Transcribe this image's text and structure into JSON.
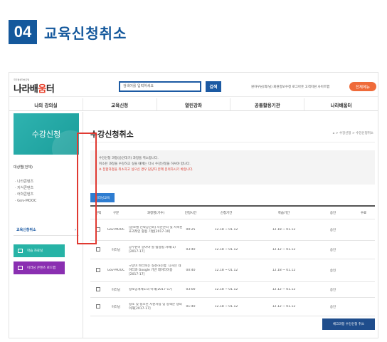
{
  "heading": {
    "number": "04",
    "title": "교육신청취소"
  },
  "site": {
    "logo_sub": "국가평생학습포털",
    "logo_part1": "나라배",
    "logo_part2": "움",
    "logo_part3": "터",
    "search_placeholder": "검색어를 입력하세요",
    "search_button": "검색",
    "util_links": "원하우님(외/님) 회원정보수정 로그아웃 고객지원 사이트맵",
    "sitemap_button": "전체메뉴"
  },
  "gnb": [
    "나의 강의실",
    "교육신청",
    "열린강좌",
    "공통활용기관",
    "나라배움터"
  ],
  "sidebar": {
    "hero": "수강신청",
    "section1": "대상별(전체)",
    "sub_items": [
      "· 나라콘텐츠",
      "· 지식콘텐츠",
      "· 어학콘텐츠",
      "· Gov-MOOC"
    ],
    "active": "교육신청취소",
    "active_arrow": "›",
    "buttons": [
      {
        "label": "학습 자료실",
        "color": "#27b3a6"
      },
      {
        "label": "이러닝 콘텐츠 로드맵",
        "color": "#8a2fb1"
      }
    ]
  },
  "main": {
    "title": "수강신청취소",
    "location": "⌂ > 수강신청 > 수강신청취소",
    "notice": [
      "수강신청 과정(승인대기) 과정을 취소합니다.",
      "취소된 과정을 수강하고 싶을 때에는 다시 수강신청을 하셔야 합니다.",
      "※ 집합과정을 취소하고 싶으신 경우 담당자 분께 문의하시기 바랍니다."
    ],
    "tab": "이러닝교육",
    "columns": [
      "선택",
      "구분",
      "과정명(기수)",
      "인정시간",
      "신청기간",
      "학습기간",
      "승인",
      "수료"
    ],
    "rows": [
      {
        "type": "Gov-MOOC",
        "subject": "[글로벌 전략공인회] 자산관리 및 저축된 효과적인 활용 기법[2017-10]",
        "time": "00:25",
        "apply": "12.18 ~ 01.12",
        "study": "12.18 ~ 01.12",
        "approve": "승인",
        "done": ""
      },
      {
        "type": "이러닝",
        "subject": "공무원이 알아야 할 범정법 사례(1)[2017-17]",
        "time": "03:40",
        "apply": "12.18 ~ 01.12",
        "study": "12.12 ~ 01.12",
        "approve": "승인",
        "done": ""
      },
      {
        "type": "Gov-MOOC",
        "subject": "구글이 바라보는 실천하는법: 디자인 데이터과 Google 기반 데이터이용[2017-17]",
        "time": "00:40",
        "apply": "12.18 ~ 01.12",
        "study": "12.18 ~ 01.12",
        "approve": "승인",
        "done": ""
      },
      {
        "type": "이러닝",
        "subject": "정보공개제도의 이해[2017-17]",
        "time": "03:00",
        "apply": "12.18 ~ 01.12",
        "study": "12.12 ~ 01.12",
        "approve": "승인",
        "done": ""
      },
      {
        "type": "이러닝",
        "subject": "청소 및 청소년 지원사업 및 정책분 쟁의 이해[2017-17]",
        "time": "01:40",
        "apply": "12.18 ~ 01.12",
        "study": "12.12 ~ 01.12",
        "approve": "승인",
        "done": ""
      }
    ],
    "cancel_button": "체크과정 수강신청 취소"
  }
}
